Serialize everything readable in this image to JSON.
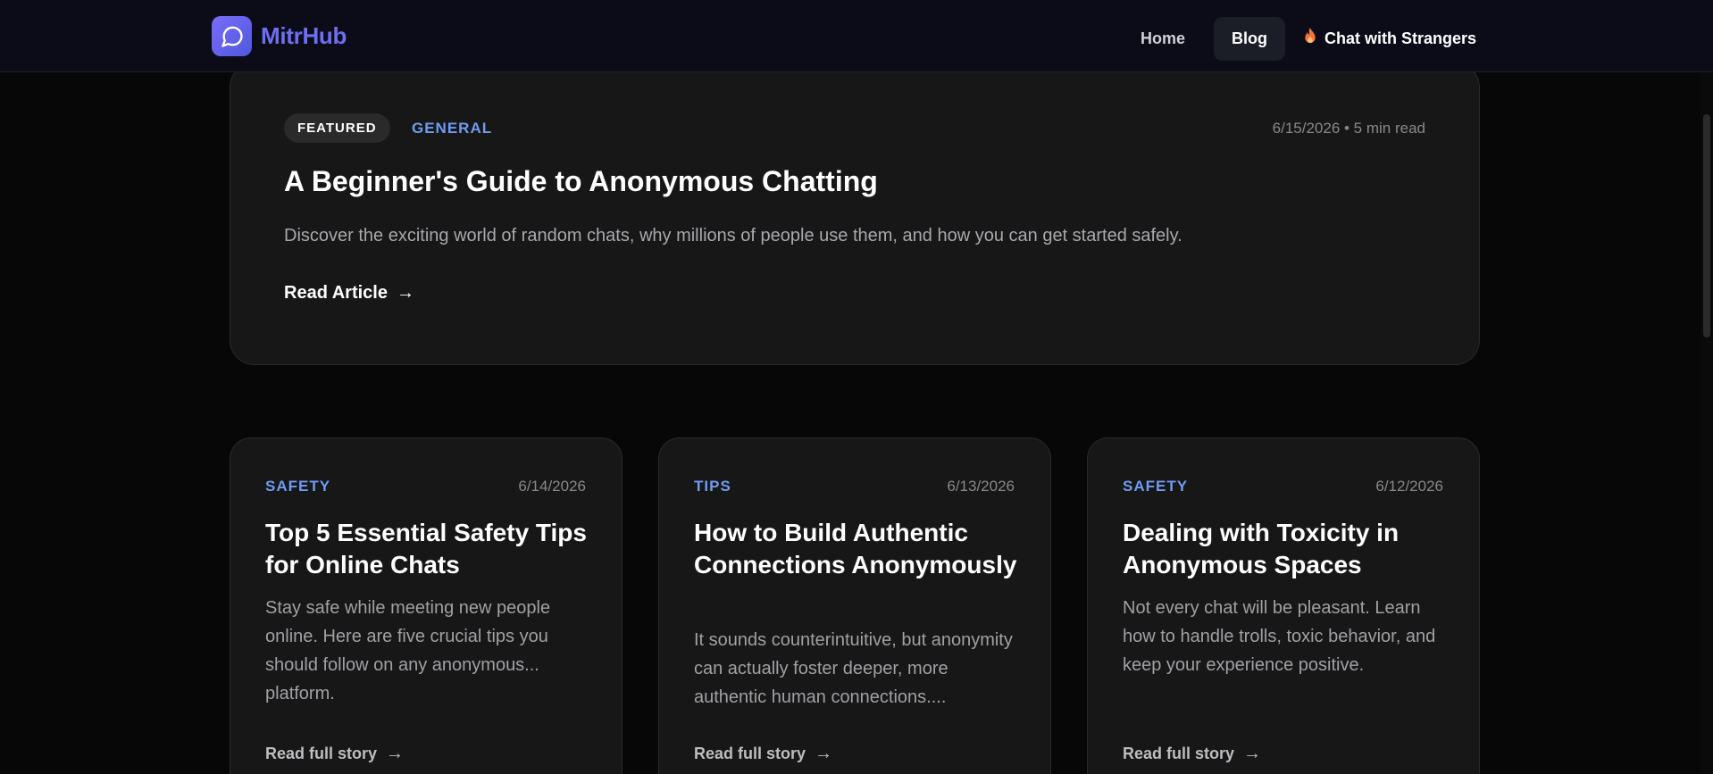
{
  "header": {
    "brand": "MitrHub",
    "nav": {
      "home": "Home",
      "blog": "Blog",
      "cta": "Chat with Strangers"
    },
    "accent": "#6e6ef0"
  },
  "featured": {
    "badge": "FEATURED",
    "category": "GENERAL",
    "meta": "6/15/2026 • 5 min read",
    "title": "A Beginner's Guide to Anonymous Chatting",
    "description": "Discover the exciting world of random chats, why millions of people use them, and how you can get started safely.",
    "link": "Read Article",
    "arrow": "→"
  },
  "posts": [
    {
      "category": "SAFETY",
      "date": "6/14/2026",
      "title": "Top 5 Essential Safety Tips for Online Chats",
      "description": "Stay safe while meeting new people online. Here are five crucial tips you should follow on any anonymous... platform.",
      "link": "Read full story",
      "arrow": "→"
    },
    {
      "category": "TIPS",
      "date": "6/13/2026",
      "title": "How to Build Authentic Connections Anonymously",
      "description": "It sounds counterintuitive, but anonymity can actually foster deeper, more authentic human connections....",
      "link": "Read full story",
      "arrow": "→"
    },
    {
      "category": "SAFETY",
      "date": "6/12/2026",
      "title": "Dealing with Toxicity in Anonymous Spaces",
      "description": "Not every chat will be pleasant. Learn how to handle trolls, toxic behavior, and keep your experience positive.",
      "link": "Read full story",
      "arrow": "→"
    }
  ],
  "colors": {
    "category": "#6f9cf2",
    "background": "#070707",
    "card": "#171717"
  }
}
